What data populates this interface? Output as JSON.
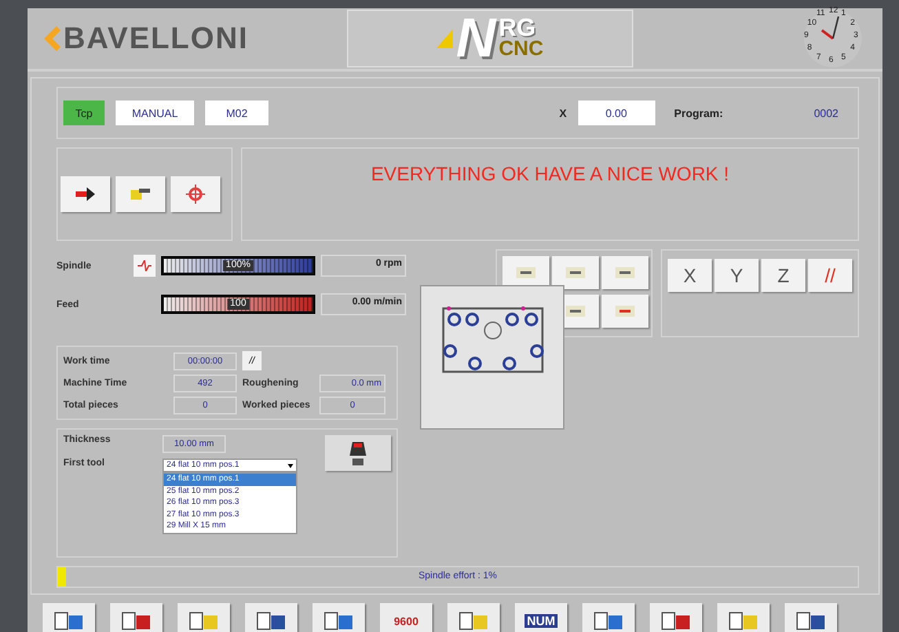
{
  "header": {
    "brand": "BAVELLONI",
    "product_main": "N",
    "product_top": "RG",
    "product_sub": "CNC",
    "clock_numbers": [
      "12",
      "1",
      "2",
      "3",
      "4",
      "5",
      "6",
      "7",
      "8",
      "9",
      "10",
      "11"
    ]
  },
  "status": {
    "mode_badge": "Tcp",
    "mode": "MANUAL",
    "code": "M02",
    "axis_label": "X",
    "axis_value": "0.00",
    "program_label": "Program:",
    "program_value": "0002"
  },
  "message": "EVERYTHING OK HAVE A NICE WORK !",
  "meters": [
    {
      "label": "Spindle",
      "kind": "spindle",
      "bar_text": "100%",
      "level": 1,
      "reading": "0 rpm"
    },
    {
      "label": "Feed",
      "kind": "feed",
      "bar_text": "100",
      "level": 1,
      "reading": "0.00 m/min"
    }
  ],
  "axis_buttons": [
    "X",
    "Y",
    "Z",
    "//"
  ],
  "counters": [
    {
      "label": "Work time",
      "value": "00:00:00"
    },
    {
      "label": "Machine Time",
      "value": "492"
    },
    {
      "label": "Roughening",
      "value": "0.0 mm"
    },
    {
      "label": "Total pieces",
      "value": "0"
    },
    {
      "label": "Worked pieces",
      "value": "0"
    }
  ],
  "reset_button": "//",
  "thickness": {
    "label": "Thickness",
    "value": "10.00 mm"
  },
  "first_tool": {
    "label": "First tool",
    "value": "24 flat 10 mm pos.1",
    "options": [
      {
        "label": "24 flat 10 mm pos.1",
        "selected": true
      },
      {
        "label": "25 flat 10 mm pos.2",
        "selected": false
      },
      {
        "label": "26 flat 10 mm pos.3",
        "selected": false
      },
      {
        "label": "27 flat 10 mm pos.3",
        "selected": false
      },
      {
        "label": "29 Mill X 15 mm",
        "selected": false
      }
    ]
  },
  "spindle_effort": {
    "label": "Spindle effort : 1%",
    "level": 0.01
  },
  "toolbar": [
    {
      "kind": "icon"
    },
    {
      "kind": "icon"
    },
    {
      "kind": "icon"
    },
    {
      "kind": "icon"
    },
    {
      "kind": "icon"
    },
    {
      "kind": "text",
      "text": "9600"
    },
    {
      "kind": "icon"
    },
    {
      "kind": "text",
      "text": "NUM"
    },
    {
      "kind": "icon"
    },
    {
      "kind": "icon"
    },
    {
      "kind": "icon"
    },
    {
      "kind": "icon"
    }
  ]
}
